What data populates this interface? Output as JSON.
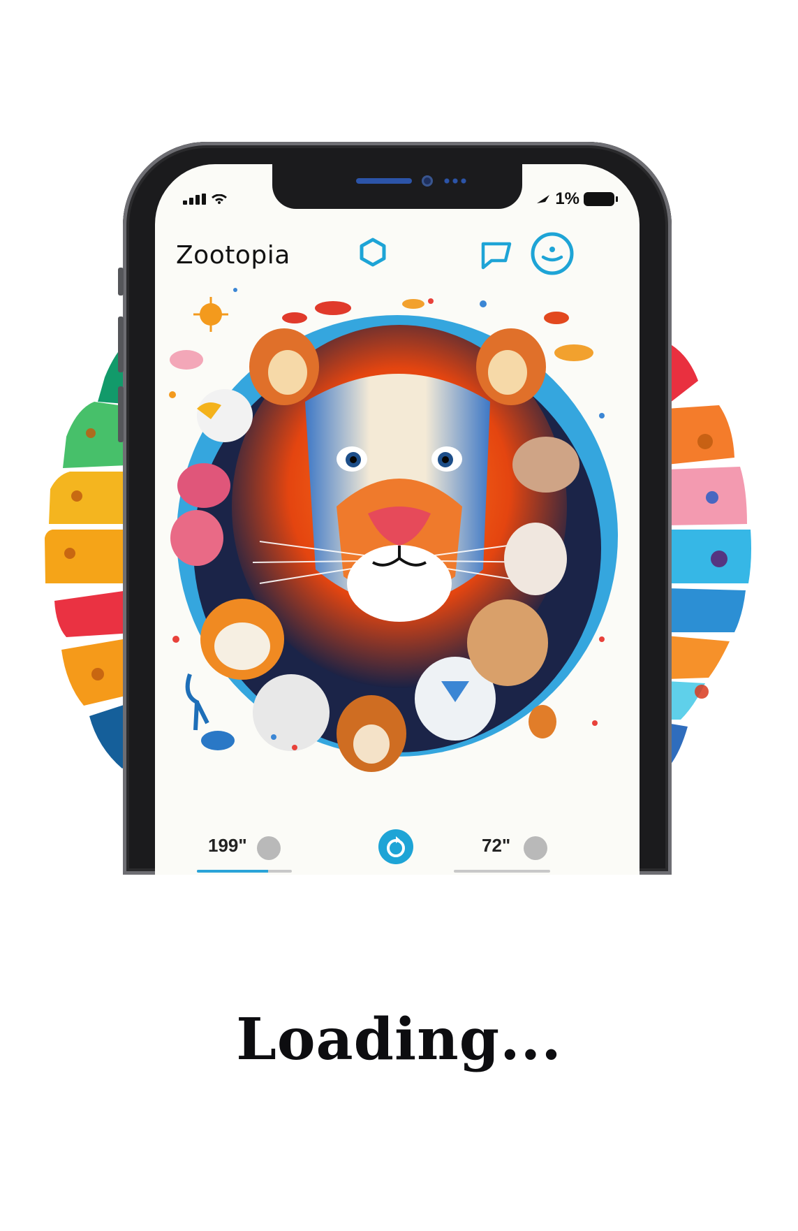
{
  "app": {
    "title": "Zootopia"
  },
  "status_bar": {
    "battery_text": "1%"
  },
  "header": {
    "icons": [
      "hexagon-icon",
      "chat-bubble-icon",
      "profile-icon"
    ]
  },
  "stats": {
    "left": {
      "value": "199\"",
      "progress": 0.75
    },
    "right": {
      "value": "72\"",
      "progress": 0.0
    }
  },
  "center_button": {
    "icon": "refresh-icon"
  },
  "loading_text": "Loading...",
  "colors": {
    "accent": "#1ea4d6",
    "fan_left": [
      "#129a6a",
      "#47c06a",
      "#f4b51f",
      "#f5a418",
      "#ea3242",
      "#f59a1a",
      "#155f9a"
    ],
    "fan_right": [
      "#e9303f",
      "#f47c2b",
      "#f39ab0",
      "#36b7e6",
      "#2c8fd4",
      "#f6912a",
      "#5fd0ea",
      "#2f6dbd"
    ]
  }
}
